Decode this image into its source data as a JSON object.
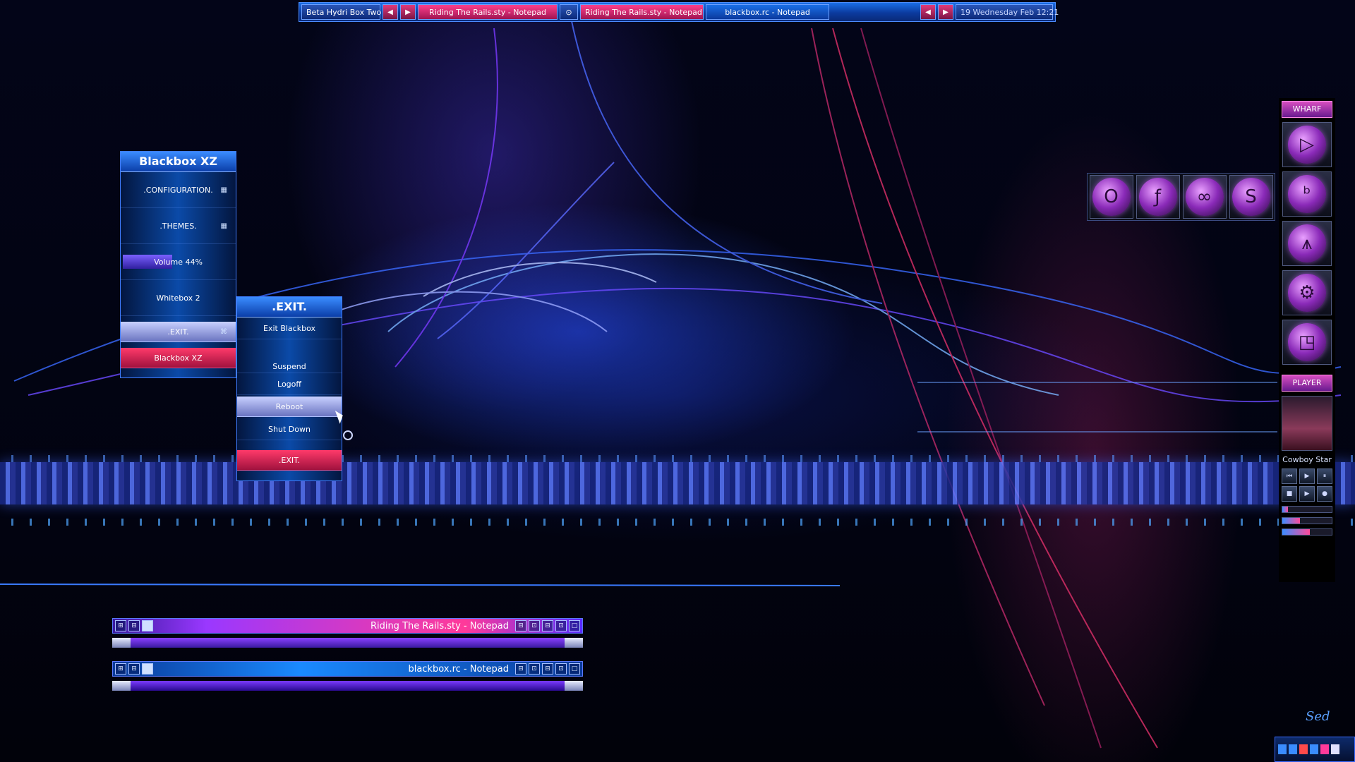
{
  "toolbar": {
    "workspace": "Beta Hydri Box Two",
    "prev_ws": "◀",
    "next_ws": "▶",
    "tasks": [
      "Riding The Rails.sty - Notepad",
      "Riding The Rails.sty - Notepad",
      "blackbox.rc - Notepad"
    ],
    "sep_icon": "⊙",
    "prev_task": "◀",
    "next_task": "▶",
    "clock": "19 Wednesday Feb 12:21"
  },
  "main_menu": {
    "title": "Blackbox XZ",
    "items": [
      ".CONFIGURATION.",
      ".THEMES.",
      "Volume  44%",
      "Whitebox 2",
      ".EXIT.",
      "Blackbox XZ"
    ],
    "submenu_marker": "▦",
    "pin_marker": "⌘",
    "volume_level": 0.44
  },
  "exit_menu": {
    "title": ".EXIT.",
    "items": [
      "Exit  Blackbox",
      "Suspend",
      "Logoff",
      "Reboot",
      "Shut Down",
      ".EXIT."
    ]
  },
  "wharf": {
    "label": "WHARF",
    "icons": [
      "play-orb-icon",
      "bbstyle-orb-icon",
      "arrow-up-orb-icon",
      "settings-orb-icon",
      "window-orb-icon"
    ],
    "glyphs": [
      "▷",
      "ᵇ",
      "⩚",
      "⚙",
      "◳"
    ]
  },
  "launcher": {
    "icons": [
      "opera-icon",
      "firefox-icon",
      "network-icon",
      "skype-icon"
    ],
    "glyphs": [
      "O",
      "ƒ",
      "∞",
      "S"
    ]
  },
  "player": {
    "label": "PLAYER",
    "song": "Cowboy Star",
    "controls": [
      "⏮",
      "▶",
      "⏸",
      "■",
      "▶",
      "●"
    ],
    "seek": 0.12,
    "volume": 0.35,
    "balance": 0.55
  },
  "windows": [
    {
      "title": "Riding The Rails.sty - Notepad",
      "active": true
    },
    {
      "title": "blackbox.rc - Notepad",
      "active": false
    }
  ],
  "signature": "Sed",
  "colors": {
    "accent_blue": "#1a6ee6",
    "accent_pink": "#ff3f8c",
    "accent_purple": "#9a38ff"
  }
}
